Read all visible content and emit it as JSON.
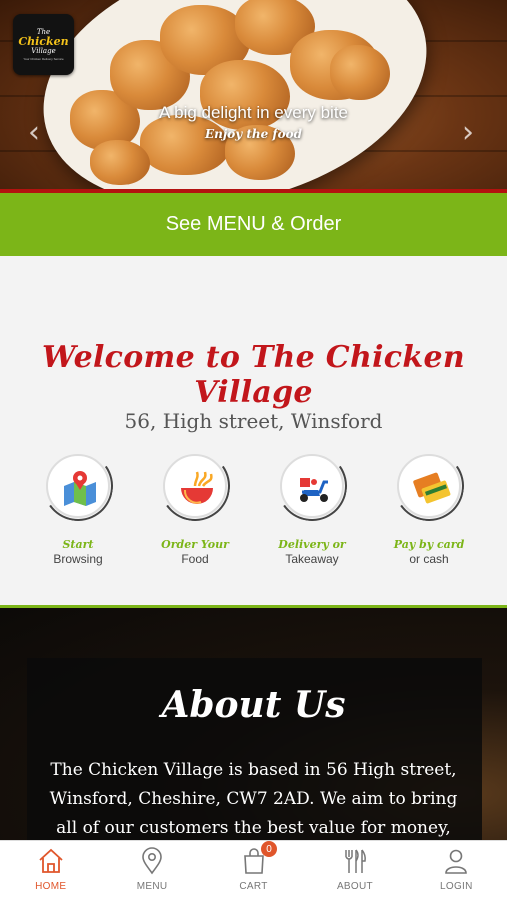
{
  "hero": {
    "logo": {
      "line1": "The",
      "line2": "Chicken",
      "line3": "Village",
      "tagline": "Your Chicken Delivery Service"
    },
    "slide_title": "A big delight in every bite",
    "slide_subtitle": "Enjoy the food",
    "prev_arrow": "‹",
    "next_arrow": "›"
  },
  "cta": {
    "label": "See MENU & Order"
  },
  "welcome": {
    "title": "Welcome to The Chicken Village",
    "address": "56, High street, Winsford",
    "features": [
      {
        "title": "Start",
        "subtitle": "Browsing",
        "icon": "map-pin-icon"
      },
      {
        "title": "Order Your",
        "subtitle": "Food",
        "icon": "food-bowl-icon"
      },
      {
        "title": "Delivery or",
        "subtitle": "Takeaway",
        "icon": "scooter-icon"
      },
      {
        "title": "Pay by card",
        "subtitle": "or cash",
        "icon": "payment-card-icon"
      }
    ]
  },
  "about": {
    "title": "About Us",
    "text": "The Chicken Village is based in 56 High street, Winsford, Cheshire, CW7 2AD. We aim to bring all of our customers the best value for money, services and"
  },
  "tabbar": {
    "tabs": [
      {
        "label": "HOME",
        "icon": "home-icon",
        "active": true
      },
      {
        "label": "MENU",
        "icon": "location-pin-icon",
        "active": false
      },
      {
        "label": "CART",
        "icon": "shopping-bag-icon",
        "active": false
      },
      {
        "label": "ABOUT",
        "icon": "cutlery-icon",
        "active": false
      },
      {
        "label": "LOGIN",
        "icon": "user-icon",
        "active": false
      }
    ],
    "cart_count": "0"
  },
  "colors": {
    "accent_green": "#7cb518",
    "brand_red": "#c2161b",
    "active_orange": "#e0562b"
  }
}
